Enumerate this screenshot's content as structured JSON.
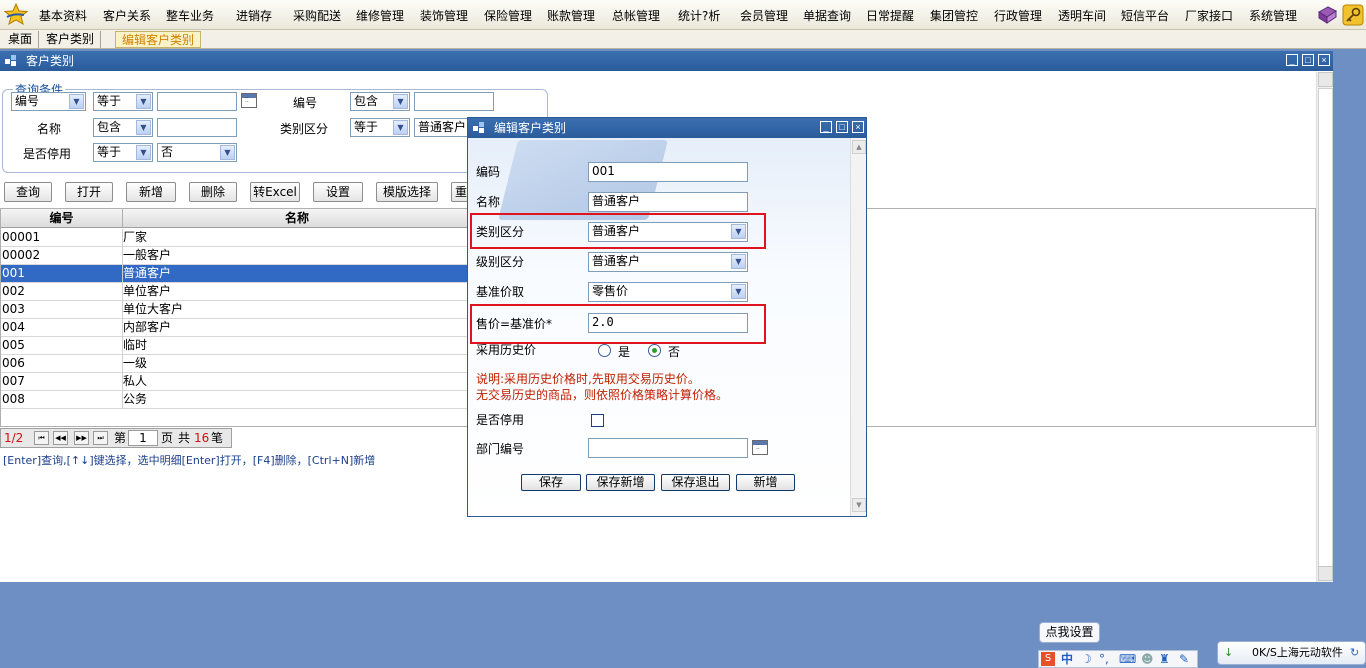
{
  "menu": {
    "items": [
      "基本资料",
      "客户关系",
      "整车业务",
      "进销存",
      "采购配送",
      "维修管理",
      "装饰管理",
      "保险管理",
      "账款管理",
      "总帐管理",
      "统计?析",
      "会员管理",
      "单据查询",
      "日常提醒",
      "集团管控",
      "行政管理",
      "透明车间",
      "短信平台",
      "厂家接口",
      "系统管理"
    ]
  },
  "tabs": [
    "桌面",
    "客户类别",
    "编辑客户类别"
  ],
  "window": {
    "title": "客户类别"
  },
  "query": {
    "legend": "查询条件",
    "row1": {
      "field1": "编号",
      "op1": "等于",
      "label2": "编号",
      "op2": "包含"
    },
    "row2": {
      "label1": "名称",
      "op1": "包含",
      "label2": "类别区分",
      "op2": "等于",
      "value2": "普通客户"
    },
    "row3": {
      "label1": "是否停用",
      "op1": "等于",
      "value1": "否"
    }
  },
  "toolbar": [
    "查询",
    "打开",
    "新增",
    "删除",
    "转Excel",
    "设置",
    "模版选择",
    "重"
  ],
  "grid": {
    "columns": [
      "编号",
      "名称"
    ],
    "rows": [
      [
        "00001",
        "厂家"
      ],
      [
        "00002",
        "一般客户"
      ],
      [
        "001",
        "普通客户"
      ],
      [
        "002",
        "单位客户"
      ],
      [
        "003",
        "单位大客户"
      ],
      [
        "004",
        "内部客户"
      ],
      [
        "005",
        "临时"
      ],
      [
        "006",
        "一级"
      ],
      [
        "007",
        "私人"
      ],
      [
        "008",
        "公务"
      ]
    ],
    "selected_row": 2
  },
  "pager": {
    "page": "1/2",
    "prefix": "第",
    "current": "1",
    "suffix_page": "页",
    "total_prefix": "共",
    "total": "16",
    "total_suffix": "笔"
  },
  "hint": "[Enter]查询,[↑↓]键选择，选中明细[Enter]打开，[F4]删除，[Ctrl+N]新增",
  "dialog": {
    "title": "编辑客户类别",
    "fields": {
      "code_label": "编码",
      "code_value": "001",
      "name_label": "名称",
      "name_value": "普通客户",
      "category_label": "类别区分",
      "category_value": "普通客户",
      "level_label": "级别区分",
      "level_value": "普通客户",
      "base_price_label": "基准价取",
      "base_price_value": "零售价",
      "price_label": "售价=基准价*",
      "price_value": "2.0",
      "history_label": "采用历史价",
      "radio_yes": "是",
      "radio_no": "否",
      "note1": "说明:采用历史价格时,先取用交易历史价。",
      "note2": "无交易历史的商品，则依照价格策略计算价格。",
      "disabled_label": "是否停用",
      "dept_label": "部门编号"
    },
    "buttons": [
      "保存",
      "保存新增",
      "保存退出",
      "新增"
    ]
  },
  "taskbar": {
    "settings": "点我设置",
    "ime": "中",
    "notify": "0K/S上海元动软件"
  }
}
